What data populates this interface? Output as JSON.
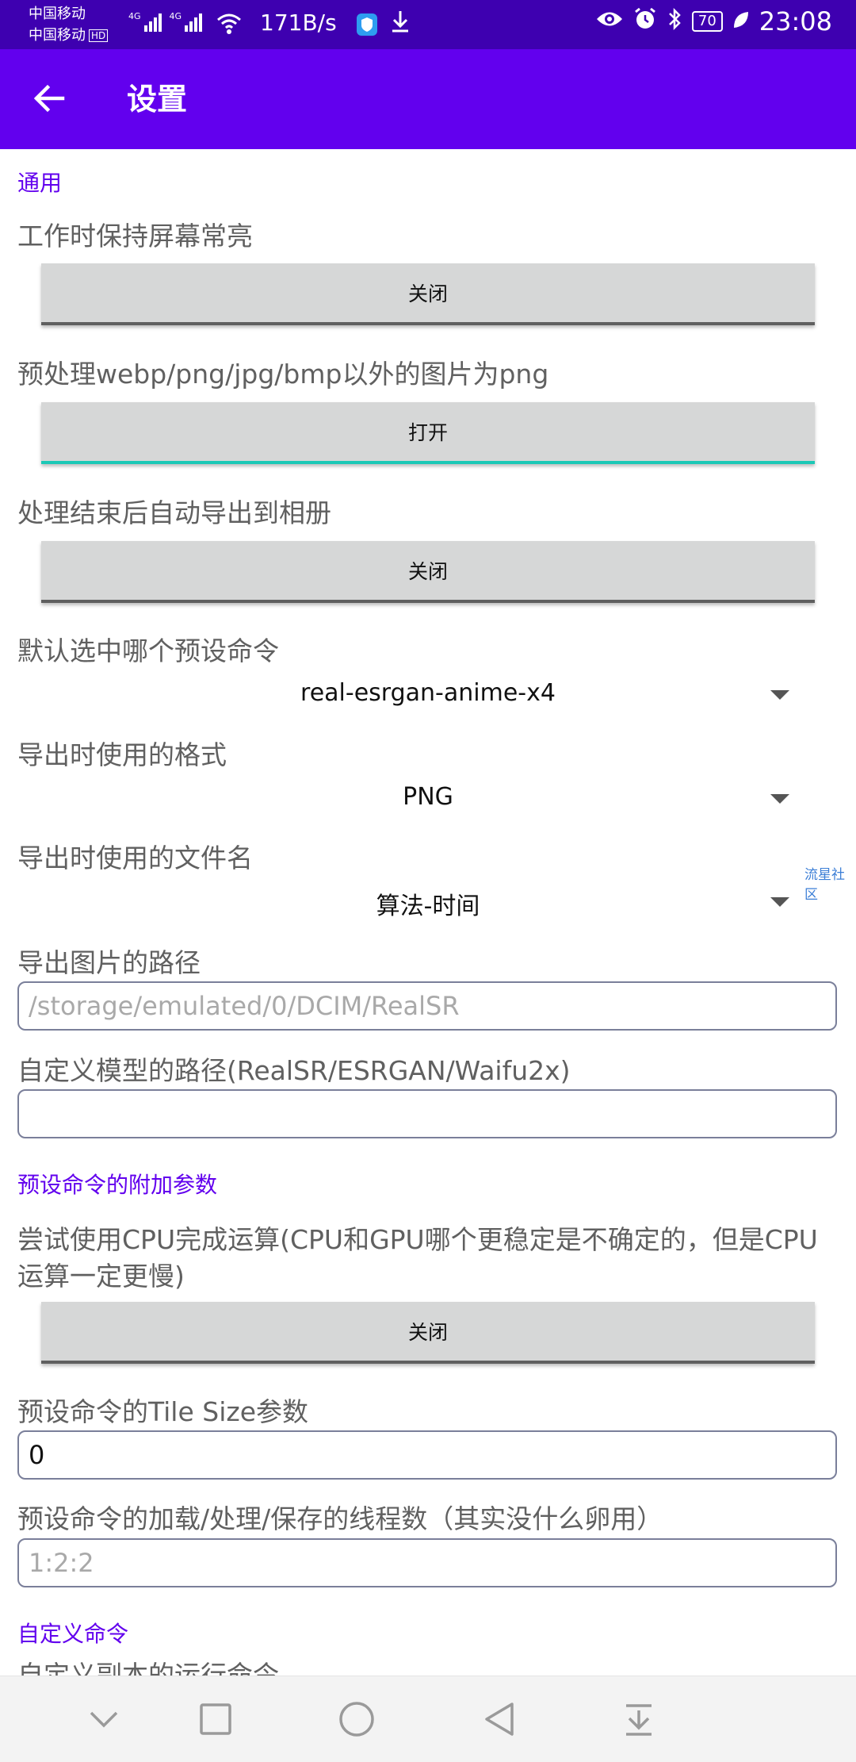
{
  "status_bar": {
    "carrier_1": "中国移动",
    "carrier_2": "中国移动",
    "hd": "HD",
    "network_1": "4G",
    "network_2": "4G",
    "speed": "171B/s",
    "battery": "70",
    "time": "23:08",
    "icons": [
      "wifi-icon",
      "shield-app-icon",
      "download-icon",
      "eye-icon",
      "alarm-icon",
      "bluetooth-icon",
      "battery-icon",
      "leaf-icon"
    ]
  },
  "app_bar": {
    "title": "设置",
    "back_icon": "arrow-left-icon",
    "color": "#6200EE"
  },
  "sections": {
    "general": "通用",
    "preset_params": "预设命令的附加参数",
    "custom_cmd": "自定义命令"
  },
  "settings": {
    "keep_screen_on": {
      "label": "工作时保持屏幕常亮",
      "state": "关闭"
    },
    "preprocess_png": {
      "label": "预处理webp/png/jpg/bmp以外的图片为png",
      "state": "打开"
    },
    "auto_export": {
      "label": "处理结束后自动导出到相册",
      "state": "关闭"
    },
    "default_preset": {
      "label": "默认选中哪个预设命令",
      "value": "real-esrgan-anime-x4"
    },
    "export_format": {
      "label": "导出时使用的格式",
      "value": "PNG"
    },
    "export_filename": {
      "label": "导出时使用的文件名",
      "value": "算法-时间"
    },
    "export_path": {
      "label": "导出图片的路径",
      "placeholder": "/storage/emulated/0/DCIM/RealSR",
      "value": ""
    },
    "custom_model_path": {
      "label": "自定义模型的路径(RealSR/ESRGAN/Waifu2x)",
      "placeholder": "",
      "value": ""
    },
    "use_cpu": {
      "label": "尝试使用CPU完成运算(CPU和GPU哪个更稳定是不确定的，但是CPU运算一定更慢)",
      "state": "关闭"
    },
    "tile_size": {
      "label": "预设命令的Tile Size参数",
      "value": "0"
    },
    "threads": {
      "label": "预设命令的加载/处理/保存的线程数（其实没什么卵用）",
      "placeholder": "1:2:2",
      "value": ""
    },
    "partial_next": "自定义副本的运行命令"
  },
  "watermark": "流星社区",
  "nav_bar": {
    "icons": [
      "chevron-down-icon",
      "square-recents-icon",
      "circle-home-icon",
      "triangle-back-icon",
      "notification-pulldown-icon"
    ]
  }
}
